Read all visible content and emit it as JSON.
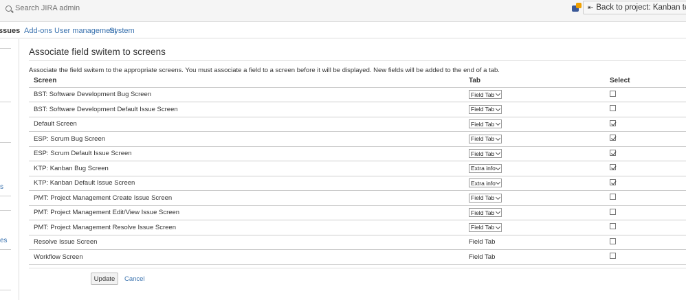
{
  "topbar": {
    "search_placeholder": "Search JIRA admin",
    "back_button_label": "Back to project: Kanban test project"
  },
  "nav": {
    "items": [
      {
        "label": "ssues",
        "active": true
      },
      {
        "label": "Add-ons"
      },
      {
        "label": "User management"
      },
      {
        "label": "System"
      }
    ]
  },
  "left_panel": {
    "links": [
      "s",
      "es"
    ]
  },
  "page": {
    "title": "Associate field switem to screens",
    "description": "Associate the field switem to the appropriate screens. You must associate a field to a screen before it will be displayed. New fields will be added to the end of a tab."
  },
  "table": {
    "headers": {
      "screen": "Screen",
      "tab": "Tab",
      "select": "Select"
    },
    "rows": [
      {
        "screen": "BST: Software Development Bug Screen",
        "tab": "Field Tab",
        "dropdown": true,
        "checked": false
      },
      {
        "screen": "BST: Software Development Default Issue Screen",
        "tab": "Field Tab",
        "dropdown": true,
        "checked": false
      },
      {
        "screen": "Default Screen",
        "tab": "Field Tab",
        "dropdown": true,
        "checked": true
      },
      {
        "screen": "ESP: Scrum Bug Screen",
        "tab": "Field Tab",
        "dropdown": true,
        "checked": true
      },
      {
        "screen": "ESP: Scrum Default Issue Screen",
        "tab": "Field Tab",
        "dropdown": true,
        "checked": true
      },
      {
        "screen": "KTP: Kanban Bug Screen",
        "tab": "Extra info",
        "dropdown": true,
        "checked": true
      },
      {
        "screen": "KTP: Kanban Default Issue Screen",
        "tab": "Extra info",
        "dropdown": true,
        "checked": true
      },
      {
        "screen": "PMT: Project Management Create Issue Screen",
        "tab": "Field Tab",
        "dropdown": true,
        "checked": false
      },
      {
        "screen": "PMT: Project Management Edit/View Issue Screen",
        "tab": "Field Tab",
        "dropdown": true,
        "checked": false
      },
      {
        "screen": "PMT: Project Management Resolve Issue Screen",
        "tab": "Field Tab",
        "dropdown": true,
        "checked": false
      },
      {
        "screen": "Resolve Issue Screen",
        "tab": "Field Tab",
        "dropdown": false,
        "checked": false
      },
      {
        "screen": "Workflow Screen",
        "tab": "Field Tab",
        "dropdown": false,
        "checked": false
      }
    ]
  },
  "actions": {
    "update_label": "Update",
    "cancel_label": "Cancel"
  },
  "icons": {
    "search": "search-icon",
    "notification": "notification-icon",
    "back_arrow": "arrow-left-icon",
    "dropdown": "chevron-down-icon",
    "checkbox": "checkbox-icon"
  },
  "colors": {
    "link": "#3b73af",
    "topbar_bg": "#f5f5f5",
    "notification_badge": "#f0a000",
    "notification_icon": "#3b5998"
  }
}
